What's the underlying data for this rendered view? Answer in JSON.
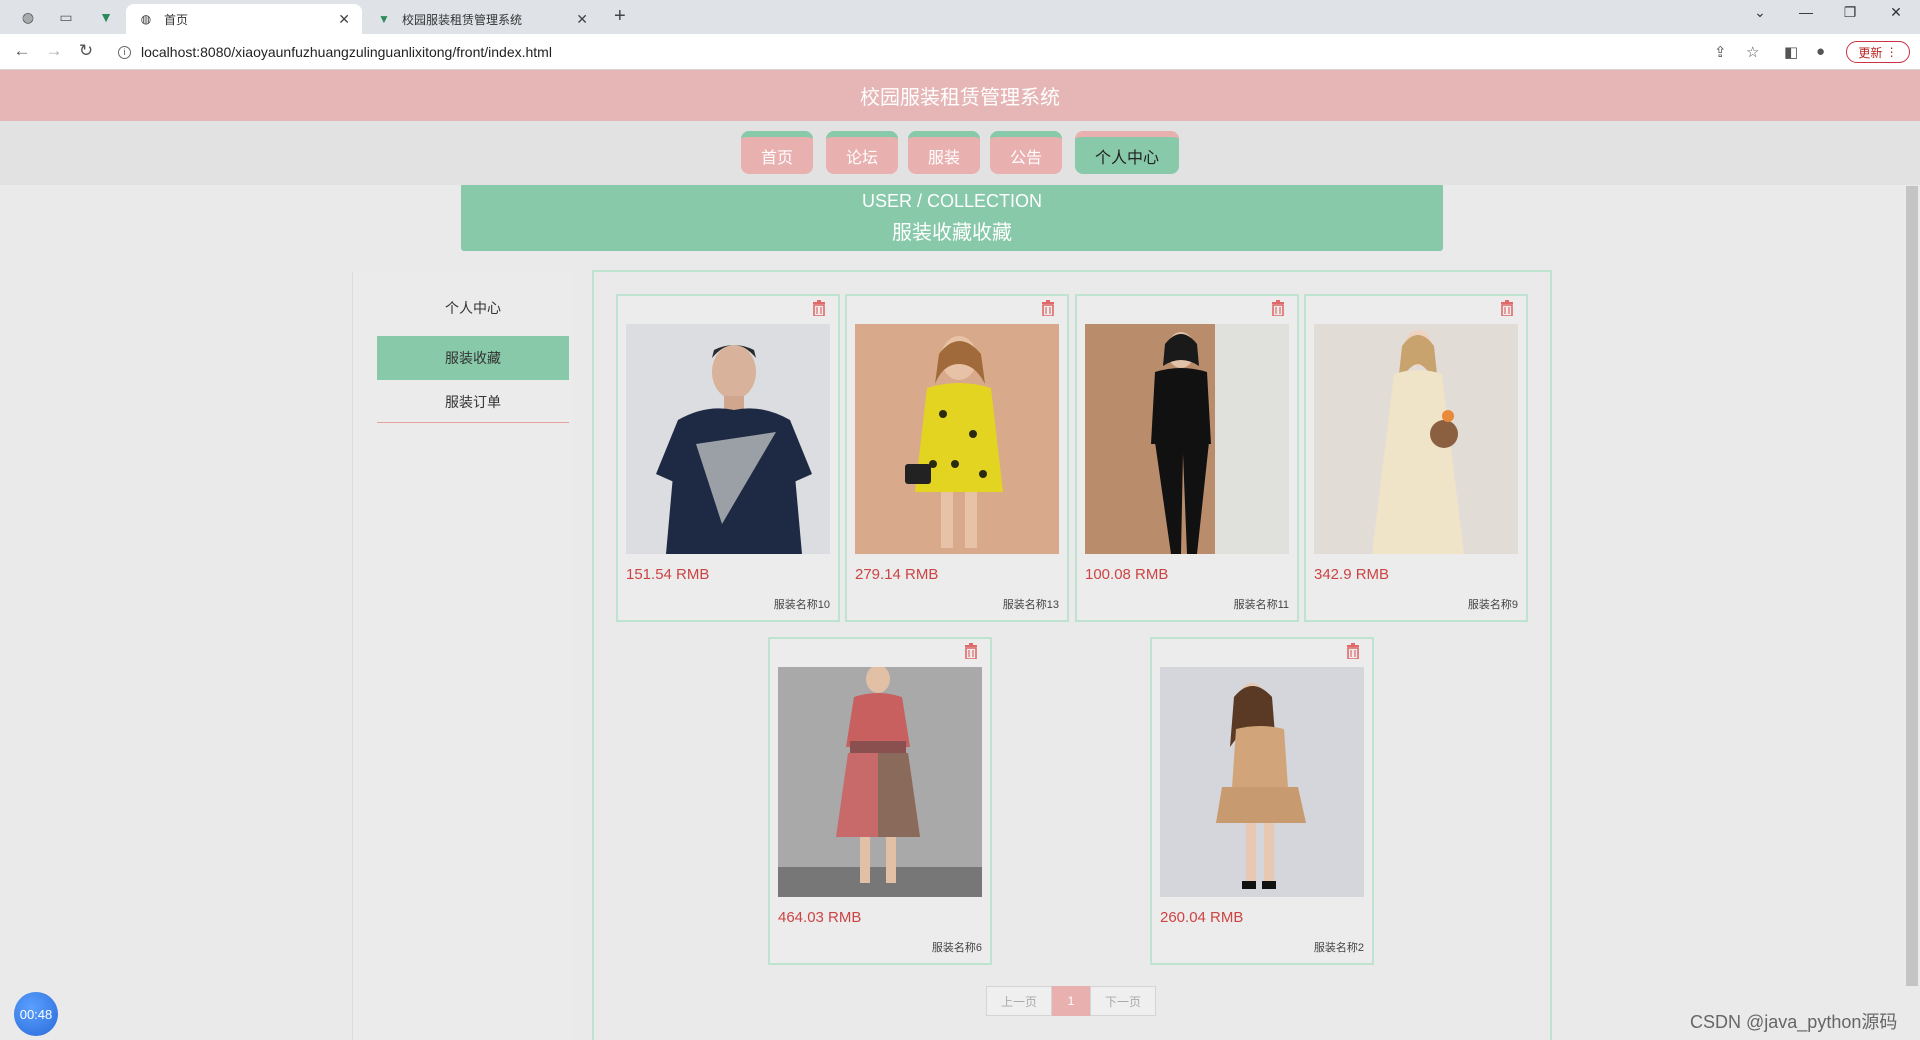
{
  "browser": {
    "tabs": [
      {
        "title": "首页",
        "active": true
      },
      {
        "title": "校园服装租赁管理系统",
        "active": false
      }
    ],
    "url": "localhost:8080/xiaoyaunfuzhuangzulinguanlixitong/front/index.html",
    "update_label": "更新"
  },
  "site": {
    "title": "校园服装租赁管理系统",
    "nav": [
      {
        "label": "首页",
        "active": false
      },
      {
        "label": "论坛",
        "active": false
      },
      {
        "label": "服装",
        "active": false
      },
      {
        "label": "公告",
        "active": false
      },
      {
        "label": "个人中心",
        "active": true
      }
    ],
    "banner": {
      "en": "USER / COLLECTION",
      "cn": "服装收藏收藏"
    }
  },
  "sidebar": {
    "items": [
      {
        "label": "个人中心",
        "active": false
      },
      {
        "label": "服装收藏",
        "active": true
      },
      {
        "label": "服装订单",
        "active": false
      }
    ]
  },
  "favorites": [
    {
      "price": "151.54 RMB",
      "name": "服装名称10"
    },
    {
      "price": "279.14 RMB",
      "name": "服装名称13"
    },
    {
      "price": "100.08 RMB",
      "name": "服装名称11"
    },
    {
      "price": "342.9 RMB",
      "name": "服装名称9"
    },
    {
      "price": "464.03 RMB",
      "name": "服装名称6"
    },
    {
      "price": "260.04 RMB",
      "name": "服装名称2"
    }
  ],
  "pagination": {
    "prev": "上一页",
    "current": "1",
    "next": "下一页"
  },
  "overlay": {
    "timer": "00:48",
    "watermark": "CSDN @java_python源码"
  },
  "colors": {
    "header_pink": "#e6b6b6",
    "accent_green": "#88c9a9",
    "price_red": "#c44444"
  }
}
